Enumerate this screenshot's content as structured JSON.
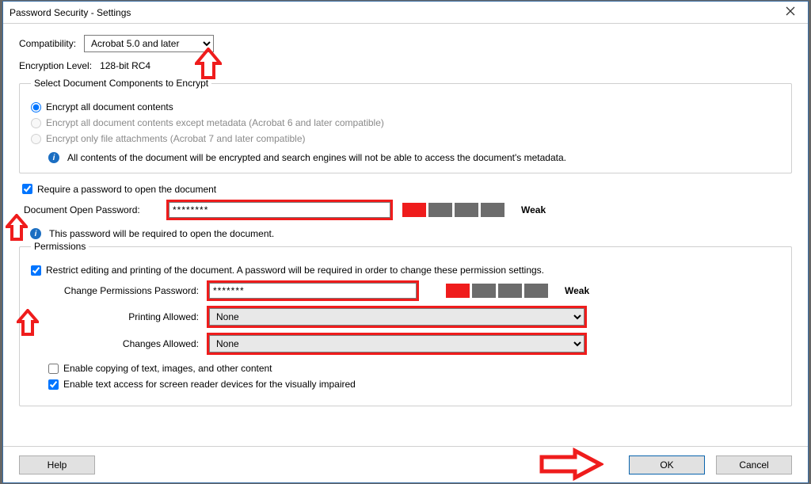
{
  "title": "Password Security - Settings",
  "compat_label": "Compatibility:",
  "compat_value": "Acrobat 5.0 and later",
  "enc_level_label": "Encryption  Level:",
  "enc_level_value": "128-bit RC4",
  "group_encrypt_legend": "Select Document Components to Encrypt",
  "radios": {
    "all": "Encrypt all document contents",
    "except_meta": "Encrypt all document contents except metadata (Acrobat 6 and later compatible)",
    "attach_only": "Encrypt only file attachments (Acrobat 7 and later compatible)"
  },
  "info_encrypt": "All contents of the document will be encrypted and search engines will not be able to access the document's metadata.",
  "require_open_pw": "Require a password to open the document",
  "doc_open_pw_label": "Document Open Password:",
  "doc_open_pw_value": "********",
  "strength_label": "Weak",
  "info_open_pw": "This password will be required to open the document.",
  "perm_legend": "Permissions",
  "restrict_label": "Restrict editing and printing of the document. A password will be required in order to change these permission settings.",
  "change_perm_pw_label": "Change Permissions Password:",
  "change_perm_pw_value": "*******",
  "printing_label": "Printing Allowed:",
  "printing_value": "None",
  "changes_label": "Changes Allowed:",
  "changes_value": "None",
  "enable_copy": "Enable copying of text, images, and other content",
  "enable_reader": "Enable text access for screen reader devices for the visually impaired",
  "help_label": "Help",
  "ok_label": "OK",
  "cancel_label": "Cancel"
}
